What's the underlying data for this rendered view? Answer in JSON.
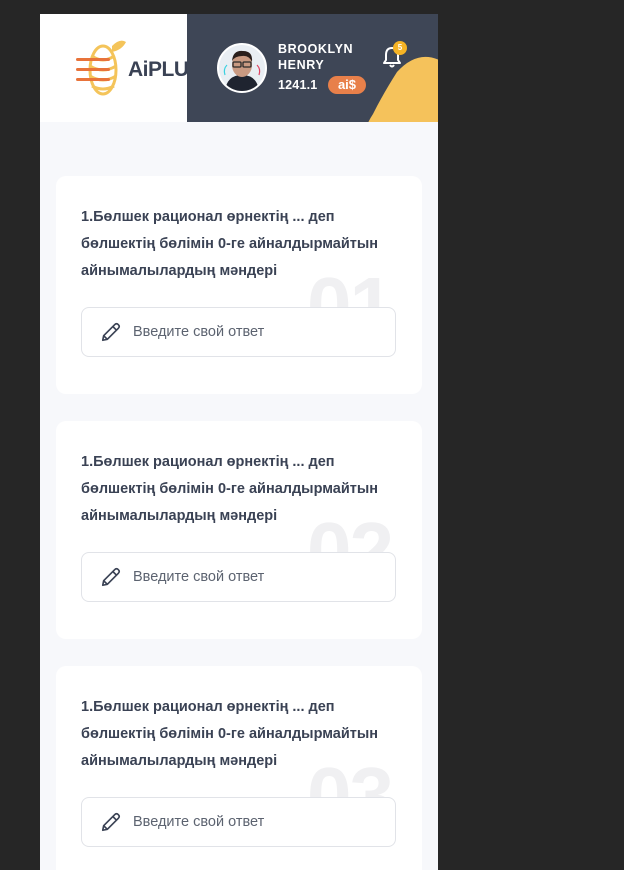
{
  "brand": {
    "text_main": "AiPLUS",
    "colors": {
      "accent": "#f2a01c",
      "dark": "#3e4656",
      "badge": "#e8804a"
    }
  },
  "user": {
    "name": "BROOKLYN HENRY",
    "balance": "1241.1",
    "currency_badge": "ai$",
    "notifications": "5"
  },
  "icons": {
    "menu": "hamburger-icon",
    "notifications": "bell-icon",
    "answer": "pencil-icon",
    "avatar": "avatar-photo"
  },
  "questions": [
    {
      "number": "01",
      "text": "1.Бөлшек рационал өрнектің ... деп бөлшектің бөлімін 0-ге айналдырмайтын айнымалылардың мәндері",
      "placeholder": "Введите свой ответ"
    },
    {
      "number": "02",
      "text": "1.Бөлшек рационал өрнектің ... деп бөлшектің бөлімін 0-ге айналдырмайтын айнымалылардың мәндері",
      "placeholder": "Введите свой ответ"
    },
    {
      "number": "03",
      "text": "1.Бөлшек рационал өрнектің ... деп бөлшектің бөлімін 0-ге айналдырмайтын айнымалылардың мәндері",
      "placeholder": "Введите свой ответ"
    }
  ]
}
